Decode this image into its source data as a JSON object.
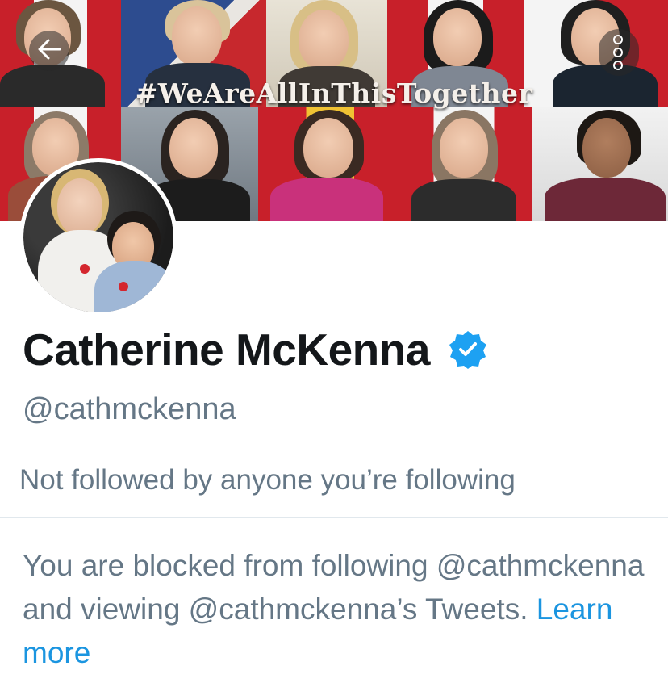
{
  "header": {
    "banner_hashtag": "#WeAreAllInThisTogether",
    "back_icon": "arrow-left-icon",
    "more_icon": "more-vertical-icon"
  },
  "profile": {
    "display_name": "Catherine McKenna",
    "verified_icon": "verified-badge-icon",
    "handle": "@cathmckenna",
    "followers_note": "Not followed by anyone you’re following"
  },
  "blocked": {
    "message": "You are blocked from following @cathmckenna and viewing @cathmckenna’s Tweets.",
    "link_label": "Learn more"
  },
  "colors": {
    "text_primary": "#14171a",
    "text_secondary": "#657786",
    "link": "#1b95e0",
    "verified": "#1da1f2",
    "divider": "#e1e8ed"
  }
}
